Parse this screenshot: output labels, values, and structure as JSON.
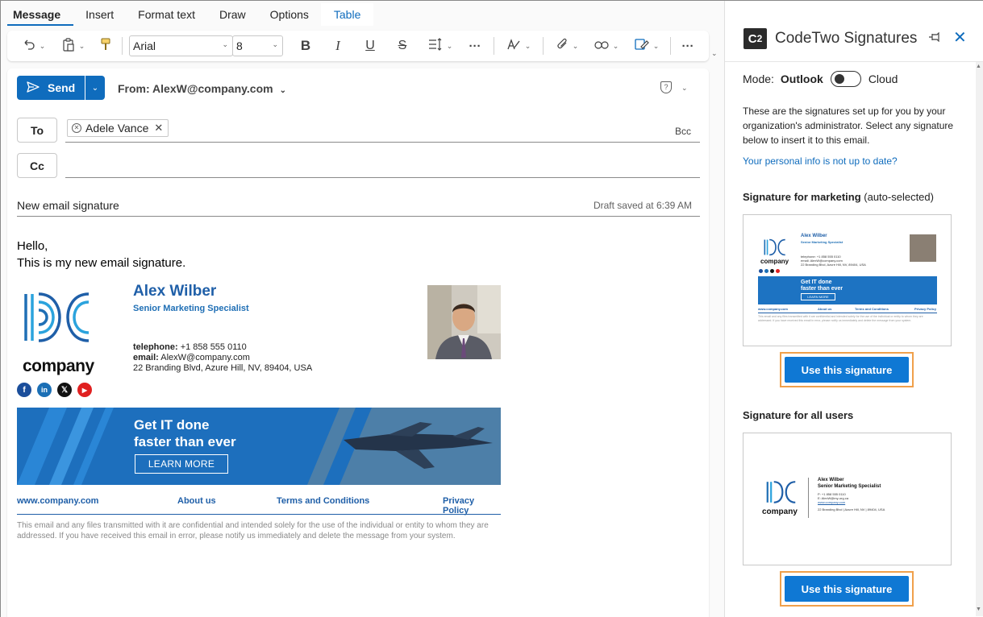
{
  "ribbon": {
    "tabs": [
      "Message",
      "Insert",
      "Format text",
      "Draw",
      "Options",
      "Table"
    ]
  },
  "toolbar": {
    "font_name": "Arial",
    "font_size": "8",
    "bold": "B",
    "italic": "I",
    "underline": "U",
    "strike": "S",
    "more": "···"
  },
  "compose": {
    "send_label": "Send",
    "from_label": "From: AlexW@company.com",
    "to_label": "To",
    "cc_label": "Cc",
    "bcc_label": "Bcc",
    "recipient": "Adele Vance",
    "subject": "New email signature",
    "draft_status": "Draft saved at 6:39 AM",
    "body_line1": "Hello,",
    "body_line2": "This is my new email signature."
  },
  "signature": {
    "logo_word": "company",
    "name": "Alex Wilber",
    "title": "Senior Marketing Specialist",
    "telephone_label": "telephone:",
    "telephone": "+1 858 555 0110",
    "email_label": "email:",
    "email": "AlexW@company.com",
    "address": "22 Branding Blvd, Azure Hill, NV, 89404, USA",
    "banner_line1": "Get IT done",
    "banner_line2": "faster than ever",
    "banner_button": "LEARN MORE",
    "link_web": "www.company.com",
    "link_about": "About us",
    "link_terms": "Terms and Conditions",
    "link_privacy": "Privacy Policy",
    "disclaimer": "This email and any files transmitted with it are confidential and intended solely for the use of the individual or entity to whom they are addressed. If you have received this email in error, please notify us immediately and delete the message from your system."
  },
  "pane": {
    "logo_text": "C",
    "logo_sup": "2",
    "title": "CodeTwo Signatures",
    "mode_label": "Mode:",
    "mode_outlook": "Outlook",
    "mode_cloud": "Cloud",
    "intro": "These are the signatures set up for you by your organization's administrator. Select any signature below to insert it to this email.",
    "info_link": "Your personal info is not up to date?",
    "section1_title": "Signature for marketing",
    "section1_note": "(auto-selected)",
    "section2_title": "Signature for all users",
    "use_button_1": "Use this signature",
    "use_button_2": "Use this signature"
  },
  "mini2": {
    "name": "Alex Wilber",
    "title": "Senior Marketing Specialist",
    "phone": "P: +1 858 555 0110",
    "email": "E: AlexW@my-org.ca",
    "web": "www.company.com",
    "address": "22 Branding Blvd | Azure Hill, NV | 89404, USA"
  },
  "colors": {
    "accent": "#0f6cbd",
    "brand_blue": "#1f5fa8",
    "highlight_border": "#f0a04b"
  }
}
